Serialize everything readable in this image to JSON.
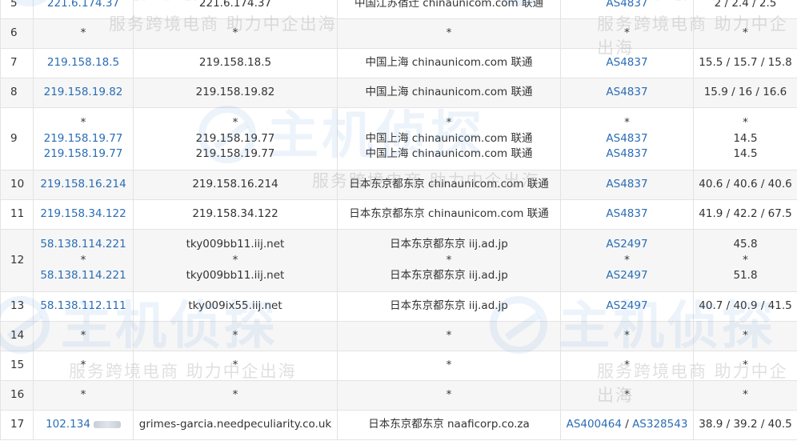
{
  "watermark": {
    "brand": "主机侦探",
    "tagline": "服务跨境电商 助力中企出海"
  },
  "rows": [
    {
      "hop": "5",
      "ip": [
        {
          "text": "221.6.174.37",
          "link": true
        }
      ],
      "host": [
        "221.6.174.37"
      ],
      "loc": [
        "中国江苏宿迁 chinaunicom.com 联通"
      ],
      "asn": [
        [
          {
            "text": "AS4837",
            "link": true
          }
        ]
      ],
      "time": [
        "2 / 2.4 / 2.5"
      ]
    },
    {
      "hop": "6",
      "ip": [
        {
          "text": "*"
        }
      ],
      "host": [
        "*"
      ],
      "loc": [
        "*"
      ],
      "asn": [
        [
          {
            "text": "*"
          }
        ]
      ],
      "time": [
        "*"
      ]
    },
    {
      "hop": "7",
      "ip": [
        {
          "text": "219.158.18.5",
          "link": true
        }
      ],
      "host": [
        "219.158.18.5"
      ],
      "loc": [
        "中国上海 chinaunicom.com 联通"
      ],
      "asn": [
        [
          {
            "text": "AS4837",
            "link": true
          }
        ]
      ],
      "time": [
        "15.5 / 15.7 / 15.8"
      ]
    },
    {
      "hop": "8",
      "ip": [
        {
          "text": "219.158.19.82",
          "link": true
        }
      ],
      "host": [
        "219.158.19.82"
      ],
      "loc": [
        "中国上海 chinaunicom.com 联通"
      ],
      "asn": [
        [
          {
            "text": "AS4837",
            "link": true
          }
        ]
      ],
      "time": [
        "15.9 / 16 / 16.6"
      ]
    },
    {
      "hop": "9",
      "ip": [
        {
          "text": "*"
        },
        {
          "text": "219.158.19.77",
          "link": true
        },
        {
          "text": "219.158.19.77",
          "link": true
        }
      ],
      "host": [
        "*",
        "219.158.19.77",
        "219.158.19.77"
      ],
      "loc": [
        "*",
        "中国上海 chinaunicom.com 联通",
        "中国上海 chinaunicom.com 联通"
      ],
      "asn": [
        [
          {
            "text": "*"
          }
        ],
        [
          {
            "text": "AS4837",
            "link": true
          }
        ],
        [
          {
            "text": "AS4837",
            "link": true
          }
        ]
      ],
      "time": [
        "*",
        "14.5",
        "14.5"
      ]
    },
    {
      "hop": "10",
      "ip": [
        {
          "text": "219.158.16.214",
          "link": true
        }
      ],
      "host": [
        "219.158.16.214"
      ],
      "loc": [
        "日本东京都东京 chinaunicom.com 联通"
      ],
      "asn": [
        [
          {
            "text": "AS4837",
            "link": true
          }
        ]
      ],
      "time": [
        "40.6 / 40.6 / 40.6"
      ]
    },
    {
      "hop": "11",
      "ip": [
        {
          "text": "219.158.34.122",
          "link": true
        }
      ],
      "host": [
        "219.158.34.122"
      ],
      "loc": [
        "日本东京都东京 chinaunicom.com 联通"
      ],
      "asn": [
        [
          {
            "text": "AS4837",
            "link": true
          }
        ]
      ],
      "time": [
        "41.9 / 42.2 / 67.5"
      ]
    },
    {
      "hop": "12",
      "ip": [
        {
          "text": "58.138.114.221",
          "link": true
        },
        {
          "text": "*"
        },
        {
          "text": "58.138.114.221",
          "link": true
        }
      ],
      "host": [
        "tky009bb11.iij.net",
        "*",
        "tky009bb11.iij.net"
      ],
      "loc": [
        "日本东京都东京 iij.ad.jp",
        "*",
        "日本东京都东京 iij.ad.jp"
      ],
      "asn": [
        [
          {
            "text": "AS2497",
            "link": true
          }
        ],
        [
          {
            "text": "*"
          }
        ],
        [
          {
            "text": "AS2497",
            "link": true
          }
        ]
      ],
      "time": [
        "45.8",
        "*",
        "51.8"
      ]
    },
    {
      "hop": "13",
      "ip": [
        {
          "text": "58.138.112.111",
          "link": true
        }
      ],
      "host": [
        "tky009ix55.iij.net"
      ],
      "loc": [
        "日本东京都东京 iij.ad.jp"
      ],
      "asn": [
        [
          {
            "text": "AS2497",
            "link": true
          }
        ]
      ],
      "time": [
        "40.7 / 40.9 / 41.5"
      ]
    },
    {
      "hop": "14",
      "ip": [
        {
          "text": "*"
        }
      ],
      "host": [
        "*"
      ],
      "loc": [
        "*"
      ],
      "asn": [
        [
          {
            "text": "*"
          }
        ]
      ],
      "time": [
        "*"
      ]
    },
    {
      "hop": "15",
      "ip": [
        {
          "text": "*"
        }
      ],
      "host": [
        "*"
      ],
      "loc": [
        "*"
      ],
      "asn": [
        [
          {
            "text": "*"
          }
        ]
      ],
      "time": [
        "*"
      ]
    },
    {
      "hop": "16",
      "ip": [
        {
          "text": "*"
        }
      ],
      "host": [
        "*"
      ],
      "loc": [
        "*"
      ],
      "asn": [
        [
          {
            "text": "*"
          }
        ]
      ],
      "time": [
        "*"
      ]
    },
    {
      "hop": "17",
      "ip": [
        {
          "text": "102.134",
          "link": true,
          "redacted": true
        }
      ],
      "host": [
        "grimes-garcia.needpeculiarity.co.uk"
      ],
      "loc": [
        "日本东京都东京 naaficorp.co.za"
      ],
      "asn": [
        [
          {
            "text": "AS400464",
            "link": true
          },
          {
            "text": " / "
          },
          {
            "text": "AS328543",
            "link": true
          }
        ]
      ],
      "time": [
        "38.9 / 39.2 / 40.5"
      ]
    }
  ]
}
